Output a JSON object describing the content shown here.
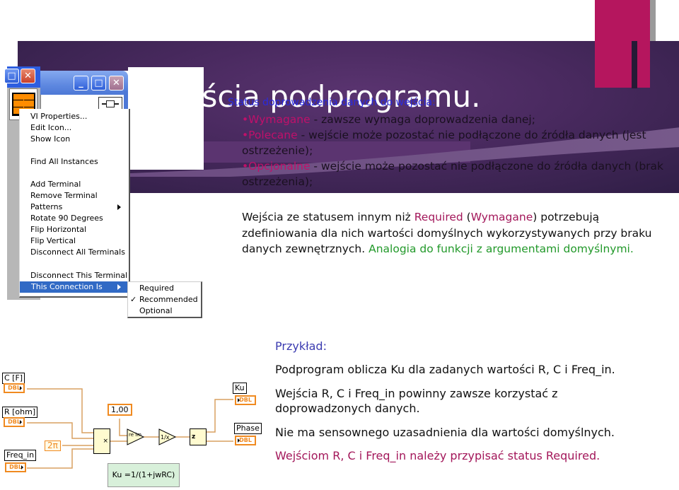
{
  "slide": {
    "title": "Wejścia podprogramu.",
    "title_visible": "ejścia podprogramu.",
    "subtitle_overlay": "Status doprowadzenia danych do wejścia:",
    "colors": {
      "banner": "#4a2a60",
      "accent": "#b5165e",
      "keyword_pink": "#c0106a",
      "green": "#22992a",
      "blue_heading": "#3b3bb0"
    }
  },
  "bullets": [
    {
      "keyword": "•Wymagane",
      "text": " - zawsze wymaga doprowadzenia danej;"
    },
    {
      "keyword": "•Polecane",
      "text": " - wejście może pozostać nie podłączone do źródła danych (jest ostrzeżenie);"
    },
    {
      "keyword": "•Opcjonalne",
      "text": " - wejście może pozostać nie podłączone do źródła danych (brak ostrzeżenia);"
    }
  ],
  "paragraph": {
    "part1": "Wejścia ze statusem innym niż ",
    "required": "Required",
    "part2": " (",
    "wymagane": "Wymagane",
    "part3": ") potrzebują zdefiniowania dla nich wartości domyślnych wykorzystywanych przy braku danych zewnętrznych. ",
    "analogy": "Analogia do funkcji z argumentami domyślnymi."
  },
  "window": {
    "buttons": {
      "minimize": "_",
      "maximize": "□",
      "close": "✕"
    }
  },
  "context_menu": {
    "items": [
      "VI Properties...",
      "Edit Icon...",
      "Show Icon",
      "Find All Instances",
      "Add Terminal",
      "Remove Terminal",
      "Patterns",
      "Rotate 90 Degrees",
      "Flip Horizontal",
      "Flip Vertical",
      "Disconnect All Terminals",
      "Disconnect This Terminal",
      "This Connection Is"
    ],
    "highlighted": "This Connection Is",
    "submenu": {
      "items": [
        "Required",
        "Recommended",
        "Optional"
      ],
      "checked": "Recommended",
      "check_mark": "✓"
    }
  },
  "example": {
    "heading": "Przykład:",
    "lines": [
      "Podprogram oblicza Ku dla zadanych wartości R, C i Freq_in.",
      "Wejścia R, C i Freq_in powinny zawsze korzystać z",
      "doprowadzonych danych.",
      "Nie ma sensownego uzasadnienia dla wartości domyślnych.",
      "Wejściom R, C i Freq_in należy przypisać status Required."
    ]
  },
  "diagram": {
    "inputs": [
      {
        "label": "C [F]",
        "type": "DBL"
      },
      {
        "label": "R [ohm]",
        "type": "DBL"
      },
      {
        "label": "Freq_in",
        "type": "DBL"
      }
    ],
    "constants": {
      "one": "1,00",
      "two_pi": "2π"
    },
    "nodes": {
      "multiply": "×",
      "re_im_to_z": "re im z",
      "reciprocal": "1/x",
      "polar": "z r θ"
    },
    "outputs": [
      {
        "label": "Ku",
        "type": "DBL"
      },
      {
        "label": "Phase",
        "type": "DBL"
      }
    ],
    "formula": "Ku =1/(1+jwRC)",
    "wire_color": "#d9a060"
  }
}
